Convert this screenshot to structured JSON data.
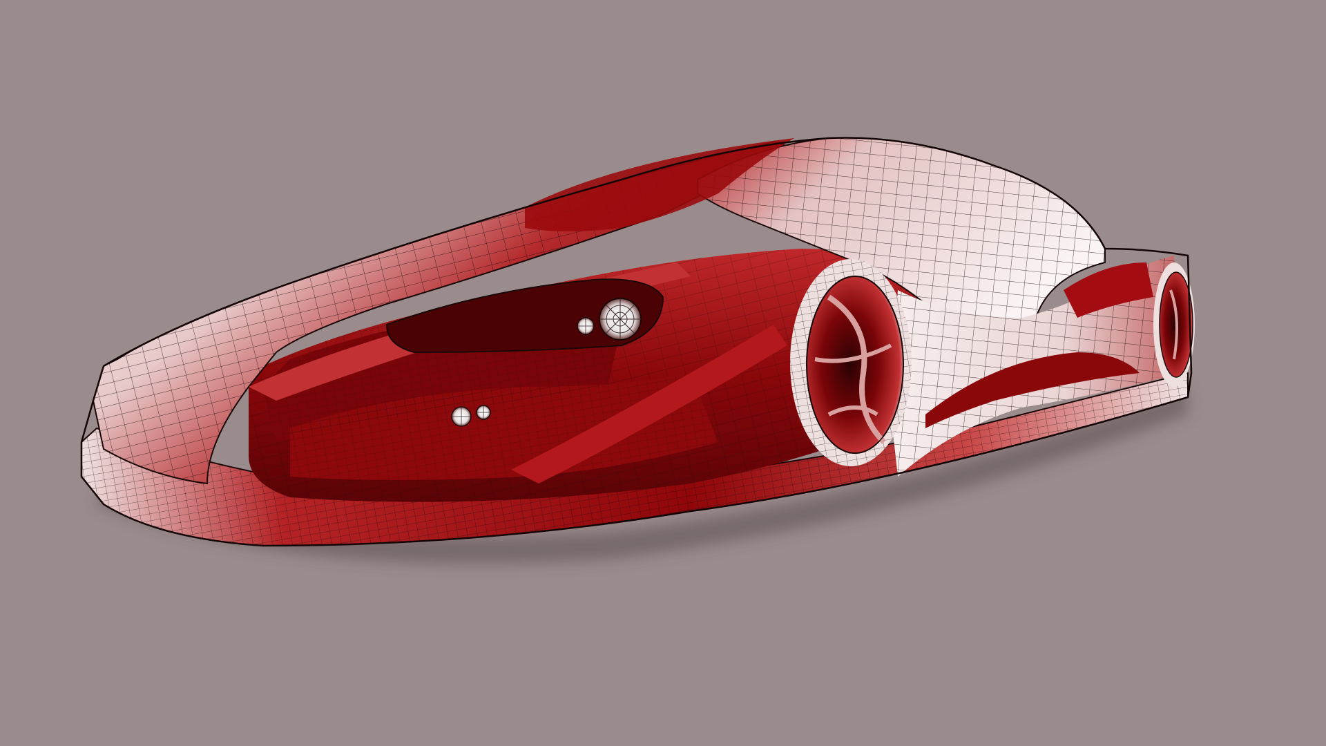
{
  "viewport": {
    "background_color": "#9a8b8c",
    "shading_mode": "wireframe-on-shaded"
  },
  "model": {
    "subject": "concept-car",
    "body_color": "#a30d12",
    "body_dark_color": "#5a0306",
    "highlight_color": "#f6eaea",
    "wire_color": "#1a0d0d"
  }
}
